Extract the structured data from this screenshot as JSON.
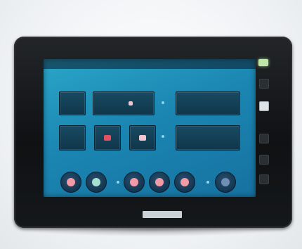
{
  "device": {
    "brand_label": "",
    "status_bar": {
      "left_text": "",
      "right_items": [
        "",
        "",
        ""
      ]
    },
    "tiles": [
      {
        "id": "t1",
        "label": ""
      },
      {
        "id": "t2",
        "label": ""
      },
      {
        "id": "t3",
        "label": ""
      },
      {
        "id": "t4",
        "label": ""
      },
      {
        "id": "t5",
        "label": ""
      },
      {
        "id": "t6",
        "label": ""
      },
      {
        "id": "t7",
        "label": ""
      }
    ],
    "round_buttons": [
      {
        "id": "b1",
        "color": "#f39aa7"
      },
      {
        "id": "b2",
        "color": "#a6e0d2"
      },
      {
        "id": "b3",
        "color": "#f39aa7"
      },
      {
        "id": "b4",
        "color": "#f39aa7"
      },
      {
        "id": "b5",
        "color": "#f39aa7"
      },
      {
        "id": "b6",
        "color": "#6f8fb5"
      }
    ],
    "indicator_colors": {
      "red": "#e25062",
      "pink": "#f1c7cf",
      "accent_screen": "#1b86b2",
      "led_green": "#bfe7a8"
    }
  }
}
